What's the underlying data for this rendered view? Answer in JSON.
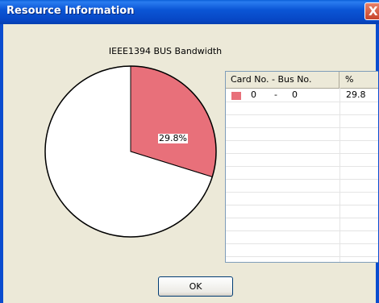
{
  "window": {
    "title": "Resource Information",
    "close_glyph": "X"
  },
  "chart_data": {
    "type": "pie",
    "title": "IEEE1394 BUS Bandwidth",
    "slices": [
      {
        "label": "29.8%",
        "value": 29.8,
        "color": "#e8707a"
      },
      {
        "label": "",
        "value": 70.2,
        "color": "#ffffff"
      }
    ]
  },
  "table": {
    "columns": [
      "Card No. - Bus No.",
      "%"
    ],
    "rows": [
      {
        "card": "0",
        "sep": "-",
        "bus": "0",
        "percent": "29.8",
        "color": "#e8707a"
      }
    ]
  },
  "buttons": {
    "ok": "OK"
  }
}
